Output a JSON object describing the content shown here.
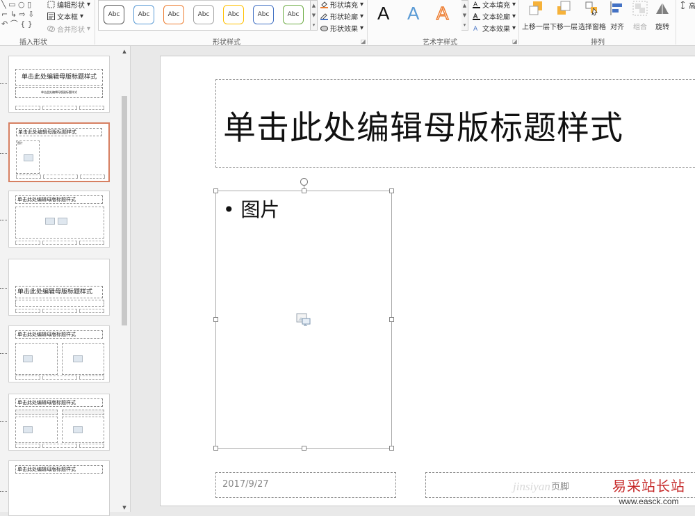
{
  "ribbon": {
    "insert_shapes": {
      "edit_shape": "编辑形状",
      "text_box": "文本框",
      "merge_shapes": "合并形状",
      "group_label": "插入形状"
    },
    "shape_styles": {
      "gallery_items": [
        "Abc",
        "Abc",
        "Abc",
        "Abc",
        "Abc",
        "Abc",
        "Abc"
      ],
      "gallery_colors": [
        "#333333",
        "#5b9bd5",
        "#ed7d31",
        "#a5a5a5",
        "#ffc000",
        "#4472c4",
        "#70ad47"
      ],
      "shape_fill": "形状填充",
      "shape_outline": "形状轮廓",
      "shape_effects": "形状效果",
      "group_label": "形状样式"
    },
    "wordart": {
      "letters": [
        "A",
        "A",
        "A"
      ],
      "text_fill": "文本填充",
      "text_outline": "文本轮廓",
      "text_effects": "文本效果",
      "group_label": "艺术字样式"
    },
    "arrange": {
      "bring_forward": "上移一层",
      "send_backward": "下移一层",
      "selection_pane": "选择窗格",
      "align": "对齐",
      "group": "组合",
      "rotate": "旋转",
      "group_label": "排列"
    },
    "size": {
      "height_label": "高"
    }
  },
  "thumbnails": [
    {
      "title": "单击此处编辑母版标题样式",
      "subtitle": "单击此处编辑母版副标题样式"
    },
    {
      "title": "单击此处编辑母版标题样式",
      "bullet": "图片"
    },
    {
      "title": "单击此处编辑母版标题样式"
    },
    {
      "title": "单击此处编辑母版标题样式"
    },
    {
      "title": "单击此处编辑母版标题样式"
    },
    {
      "title": "单击此处编辑母版标题样式"
    },
    {
      "title": "单击此处编辑母版标题样式"
    }
  ],
  "slide": {
    "title": "单击此处编辑母版标题样式",
    "bullet": "• 图片",
    "date": "2017/9/27",
    "footer": "页脚"
  },
  "watermark": {
    "brand_cn": "易采站长站",
    "url": "www.easck.com",
    "overlay": "jinsiyan"
  }
}
